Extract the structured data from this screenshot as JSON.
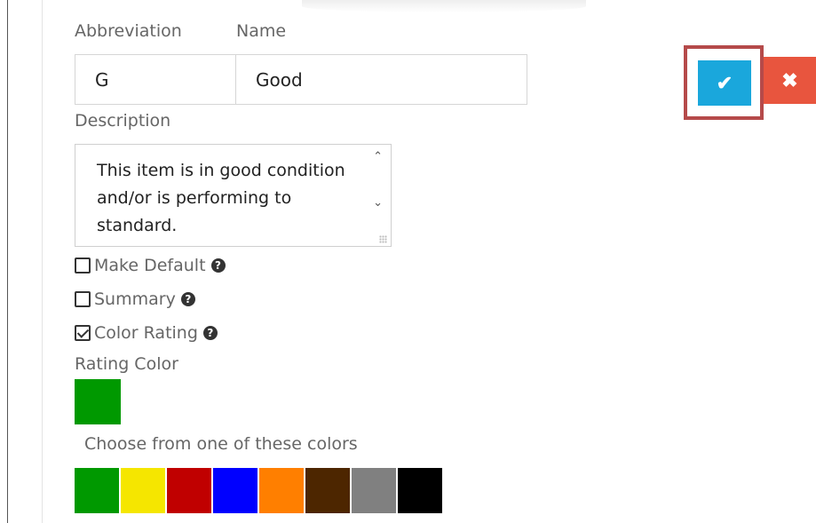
{
  "fields": {
    "abbreviation_label": "Abbreviation",
    "name_label": "Name",
    "abbreviation_value": "G",
    "name_value": "Good",
    "description_label": "Description",
    "description_value": "This item is in good condition and/or is performing to standard."
  },
  "checkboxes": [
    {
      "label": "Make Default",
      "checked": false,
      "help_icon": "question-circle-icon"
    },
    {
      "label": "Summary",
      "checked": false,
      "help_icon": "question-circle-icon"
    },
    {
      "label": "Color Rating",
      "checked": true,
      "help_icon": "question-circle-icon"
    }
  ],
  "rating": {
    "label": "Rating Color",
    "selected_color": "#009900",
    "choose_label": "Choose from one of these colors",
    "palette": [
      "#009900",
      "#f5e600",
      "#c00000",
      "#0000ff",
      "#ff7f00",
      "#4d2600",
      "#808080",
      "#000000"
    ]
  },
  "actions": {
    "confirm_icon": "check-icon",
    "confirm_glyph": "✔",
    "cancel_icon": "close-icon",
    "cancel_glyph": "✖",
    "confirm_color": "#1aa7dc",
    "cancel_color": "#e8553e",
    "highlight_color": "#b54a4a"
  },
  "icons": {
    "help_glyph": "?",
    "scroll_up_glyph": "⌃",
    "scroll_down_glyph": "⌄"
  }
}
